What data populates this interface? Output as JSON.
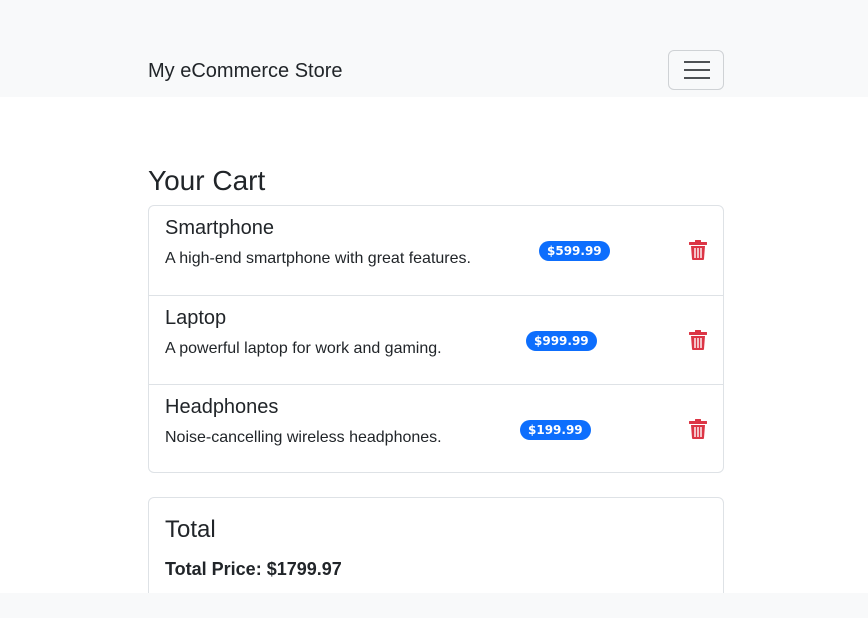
{
  "navbar": {
    "brand": "My eCommerce Store",
    "toggle_icon": "hamburger-menu-icon"
  },
  "page": {
    "title": "Your Cart"
  },
  "cart": {
    "items": [
      {
        "name": "Smartphone",
        "description": "A high-end smartphone with great features.",
        "price": "$599.99"
      },
      {
        "name": "Laptop",
        "description": "A powerful laptop for work and gaming.",
        "price": "$999.99"
      },
      {
        "name": "Headphones",
        "description": "Noise-cancelling wireless headphones.",
        "price": "$199.99"
      }
    ],
    "remove_icon": "trash-icon"
  },
  "total": {
    "title": "Total",
    "price_text": "Total Price: $1799.97"
  },
  "colors": {
    "accent": "#0d6efd",
    "danger": "#dc3545",
    "navbar_bg": "#f8f9fa",
    "border": "#dee2e6"
  }
}
